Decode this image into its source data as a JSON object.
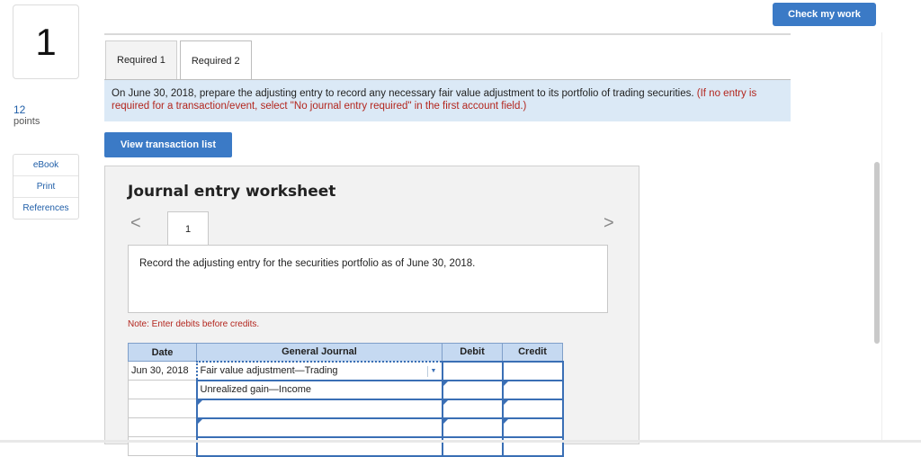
{
  "question": {
    "number": "1",
    "points_value": "12",
    "points_label": "points"
  },
  "side_links": [
    "eBook",
    "Print",
    "References"
  ],
  "header": {
    "check_label": "Check my work"
  },
  "tabs": [
    {
      "label": "Required 1",
      "active": false
    },
    {
      "label": "Required 2",
      "active": true
    }
  ],
  "instruction": {
    "text": "On June 30, 2018, prepare the adjusting entry to record any necessary fair value adjustment to its portfolio of trading securities.",
    "note": "(If no entry is required for a transaction/event, select \"No journal entry required\" in the first account field.)"
  },
  "view_button": "View transaction list",
  "worksheet": {
    "title": "Journal entry worksheet",
    "prev_symbol": "<",
    "next_symbol": ">",
    "page": "1",
    "record_text": "Record the adjusting entry for the securities portfolio as of June 30, 2018.",
    "note": "Note: Enter debits before credits.",
    "columns": {
      "date": "Date",
      "journal": "General Journal",
      "debit": "Debit",
      "credit": "Credit"
    },
    "rows": [
      {
        "date": "Jun 30, 2018",
        "account": "Fair value adjustment—Trading",
        "debit": "",
        "credit": ""
      },
      {
        "date": "",
        "account": "Unrealized gain—Income",
        "debit": "",
        "credit": ""
      },
      {
        "date": "",
        "account": "",
        "debit": "",
        "credit": ""
      },
      {
        "date": "",
        "account": "",
        "debit": "",
        "credit": ""
      },
      {
        "date": "",
        "account": "",
        "debit": "",
        "credit": ""
      }
    ]
  },
  "colors": {
    "accent": "#3b7ac6",
    "note_red": "#b3261e",
    "table_header": "#c5d9f1",
    "info_bg": "#dbe9f6"
  }
}
